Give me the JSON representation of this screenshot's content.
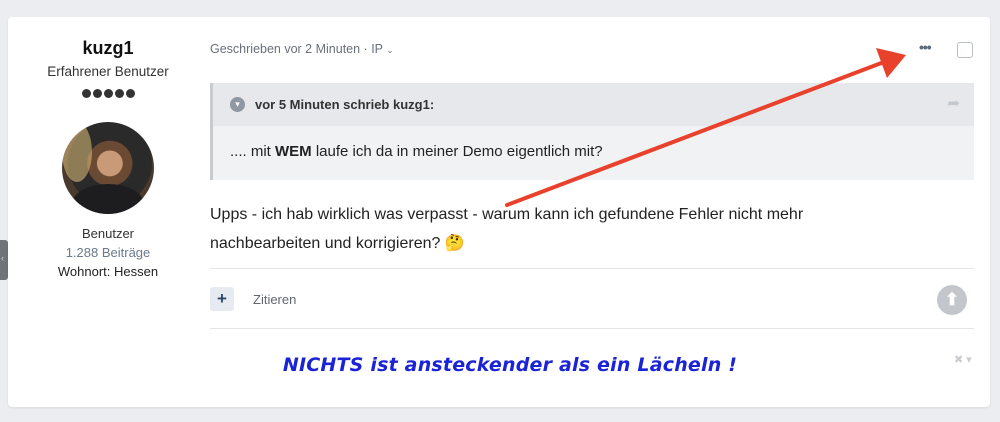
{
  "author": {
    "name": "kuzg1",
    "rank": "Erfahrener Benutzer",
    "rank_pips": 5,
    "group": "Benutzer",
    "posts": "1.288 Beiträge",
    "location": "Wohnort: Hessen"
  },
  "post": {
    "meta": "Geschrieben vor 2 Minuten · IP",
    "quote": {
      "citation": "vor 5 Minuten schrieb kuzg1:",
      "text_before": ".... mit ",
      "text_bold": "WEM",
      "text_after": " laufe ich da in meiner Demo eigentlich mit?"
    },
    "body_line1": "Upps - ich hab wirklich was verpasst - warum kann ich gefundene Fehler nicht mehr",
    "body_line2": "nachbearbeiten und korrigieren? 🤔",
    "actions": {
      "plus": "+",
      "quote_label": "Zitieren"
    },
    "signature": "NICHTS ist ansteckender als ein Lächeln !"
  },
  "icons": {
    "more": "more-horizontal-icon",
    "quote_toggle": "chevron-down-icon",
    "share": "share-icon",
    "scroll_up": "arrow-up-icon",
    "signature_hide": "close-icon"
  },
  "colors": {
    "signature": "#1a23d6",
    "annotation_arrow": "#e8412c",
    "posts_link": "#6a7a8c"
  }
}
